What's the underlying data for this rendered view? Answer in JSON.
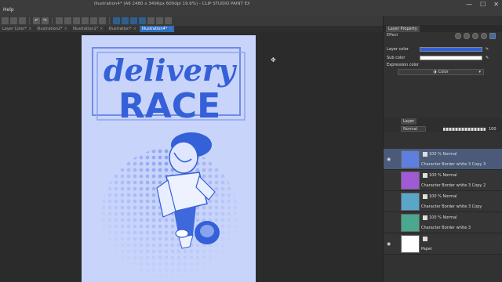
{
  "menu": {
    "help": "Help"
  },
  "window": {
    "title": "Illustration4* (A6 2480 x 3496px 600dpi 19.6%) - CLIP STUDIO PAINT EX",
    "minimize": "—",
    "maximize": "☐",
    "close": "✕"
  },
  "tabs": [
    {
      "label": "Layer Color*",
      "active": false
    },
    {
      "label": "Illustration2*",
      "active": false
    },
    {
      "label": "Illustration1*",
      "active": false
    },
    {
      "label": "Illustration*",
      "active": false
    },
    {
      "label": "Illustration4*",
      "active": true
    }
  ],
  "artwork": {
    "title_script": "delivery",
    "title_block": "RACE",
    "colors": {
      "bg": "#c9d4fb",
      "ink": "#3460d8",
      "frame": "#6f8ce6"
    }
  },
  "panel": {
    "tabs": [
      "Layer Property"
    ],
    "section": "Effect",
    "layer_color_label": "Layer color",
    "layer_color": "#2e5fde",
    "sub_color_label": "Sub color",
    "sub_color": "#ffffff",
    "expression_label": "Expression color",
    "expression_value": "Color"
  },
  "layer_panel": {
    "tabs": [
      "Layer"
    ],
    "blend_mode": "Normal",
    "opacity": "100"
  },
  "layers": [
    {
      "opacity": "100 % Normal",
      "name": "Character Border white 3 Copy 3",
      "thumb": "#5f7fe0",
      "selected": true,
      "visible": true
    },
    {
      "opacity": "100 % Normal",
      "name": "Character Border white 3 Copy 2",
      "thumb": "#a05ad6",
      "selected": false,
      "visible": false
    },
    {
      "opacity": "100 % Normal",
      "name": "Character Border white 3 Copy",
      "thumb": "#5aa6c8",
      "selected": false,
      "visible": false
    },
    {
      "opacity": "100 % Normal",
      "name": "Character Border white 3",
      "thumb": "#4aa890",
      "selected": false,
      "visible": false
    },
    {
      "opacity": "",
      "name": "Paper",
      "thumb": "#ffffff",
      "selected": false,
      "visible": true
    }
  ]
}
